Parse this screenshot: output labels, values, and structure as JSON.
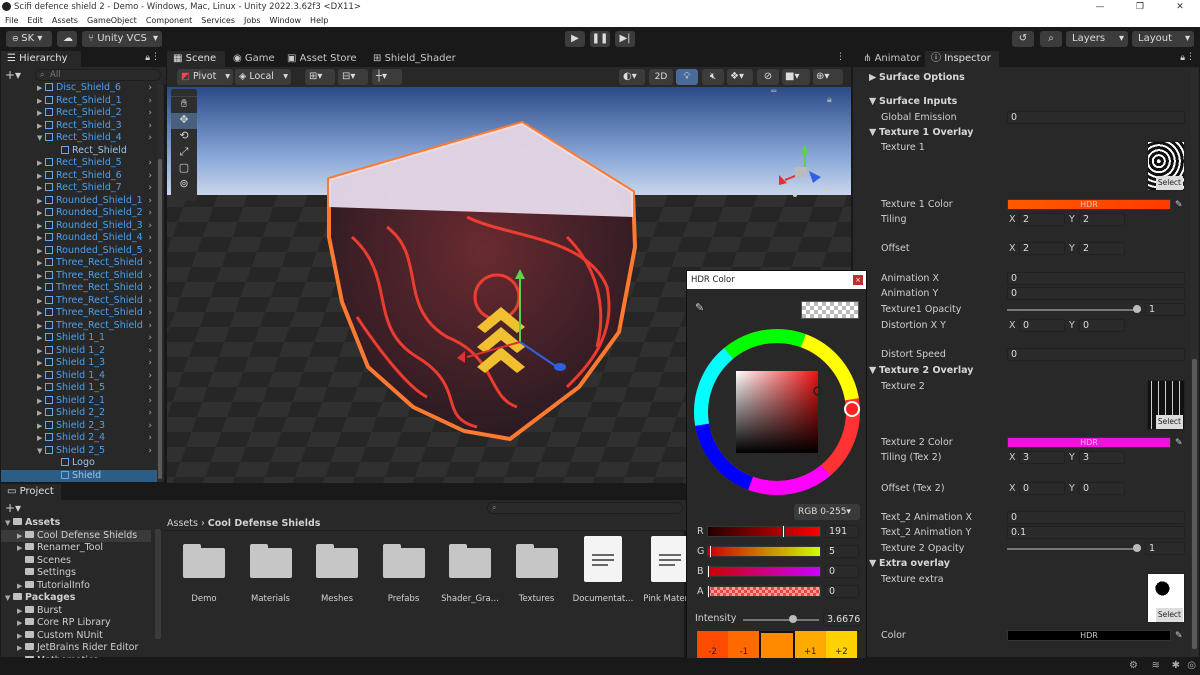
{
  "window": {
    "title": "Scifi defence shield 2 - Demo - Windows, Mac, Linux - Unity 2022.3.62f3 <DX11>",
    "minimize": "—",
    "maximize": "❐",
    "close": "✕"
  },
  "menu": [
    "File",
    "Edit",
    "Assets",
    "GameObject",
    "Component",
    "Services",
    "Jobs",
    "Window",
    "Help"
  ],
  "toolbar": {
    "account": "SK ▾",
    "vcs": "Unity VCS",
    "layers": "Layers",
    "layout": "Layout"
  },
  "hierarchy": {
    "tab": "Hierarchy",
    "search_placeholder": "All",
    "items": [
      {
        "label": "Disc_Shield_6",
        "indent": 1,
        "tri": "▶"
      },
      {
        "label": "Rect_Shield_1",
        "indent": 1,
        "tri": "▶"
      },
      {
        "label": "Rect_Shield_2",
        "indent": 1,
        "tri": "▶"
      },
      {
        "label": "Rect_Shield_3",
        "indent": 1,
        "tri": "▶"
      },
      {
        "label": "Rect_Shield_4",
        "indent": 1,
        "tri": "▼"
      },
      {
        "label": "Rect_Shield",
        "indent": 2,
        "tri": ""
      },
      {
        "label": "Rect_Shield_5",
        "indent": 1,
        "tri": "▶"
      },
      {
        "label": "Rect_Shield_6",
        "indent": 1,
        "tri": "▶"
      },
      {
        "label": "Rect_Shield_7",
        "indent": 1,
        "tri": "▶"
      },
      {
        "label": "Rounded_Shield_1",
        "indent": 1,
        "tri": "▶"
      },
      {
        "label": "Rounded_Shield_2",
        "indent": 1,
        "tri": "▶"
      },
      {
        "label": "Rounded_Shield_3",
        "indent": 1,
        "tri": "▶"
      },
      {
        "label": "Rounded_Shield_4",
        "indent": 1,
        "tri": "▶"
      },
      {
        "label": "Rounded_Shield_5",
        "indent": 1,
        "tri": "▶"
      },
      {
        "label": "Three_Rect_Shield",
        "indent": 1,
        "tri": "▶"
      },
      {
        "label": "Three_Rect_Shield",
        "indent": 1,
        "tri": "▶"
      },
      {
        "label": "Three_Rect_Shield",
        "indent": 1,
        "tri": "▶"
      },
      {
        "label": "Three_Rect_Shield",
        "indent": 1,
        "tri": "▶"
      },
      {
        "label": "Three_Rect_Shield",
        "indent": 1,
        "tri": "▶"
      },
      {
        "label": "Three_Rect_Shield",
        "indent": 1,
        "tri": "▶"
      },
      {
        "label": "Shield 1_1",
        "indent": 1,
        "tri": "▶"
      },
      {
        "label": "Shield 1_2",
        "indent": 1,
        "tri": "▶"
      },
      {
        "label": "Shield 1_3",
        "indent": 1,
        "tri": "▶"
      },
      {
        "label": "Shield 1_4",
        "indent": 1,
        "tri": "▶"
      },
      {
        "label": "Shield 1_5",
        "indent": 1,
        "tri": "▶"
      },
      {
        "label": "Shield 2_1",
        "indent": 1,
        "tri": "▶"
      },
      {
        "label": "Shield 2_2",
        "indent": 1,
        "tri": "▶"
      },
      {
        "label": "Shield 2_3",
        "indent": 1,
        "tri": "▶"
      },
      {
        "label": "Shield 2_4",
        "indent": 1,
        "tri": "▶"
      },
      {
        "label": "Shield 2_5",
        "indent": 1,
        "tri": "▼"
      },
      {
        "label": "Logo",
        "indent": 2,
        "tri": ""
      },
      {
        "label": "Shield",
        "indent": 2,
        "tri": ""
      }
    ]
  },
  "scene": {
    "tabs": [
      "Scene",
      "Game",
      "Asset Store",
      "Shield_Shader"
    ],
    "pivot": "Pivot",
    "local": "Local",
    "twod": "2D"
  },
  "inspector": {
    "tabs": [
      "Animator",
      "Inspector"
    ],
    "rows": [
      {
        "label": "Surface Options",
        "kind": "header",
        "tri": "▶"
      },
      {
        "label": "Surface Inputs",
        "kind": "header",
        "tri": "▼"
      },
      {
        "label": "Global Emission",
        "kind": "value",
        "value": "0"
      },
      {
        "label": "Texture 1 Overlay",
        "kind": "header",
        "tri": "▼"
      },
      {
        "label": "Texture 1",
        "kind": "texture"
      },
      {
        "label": "Texture 1 Color",
        "kind": "color",
        "value": "HDR"
      },
      {
        "label": "Tiling",
        "kind": "xy",
        "x": "2",
        "y": "2"
      },
      {
        "label": "Offset",
        "kind": "xy",
        "x": "2",
        "y": "2"
      },
      {
        "label": "Animation X",
        "kind": "value",
        "value": "0"
      },
      {
        "label": "Animation Y",
        "kind": "value",
        "value": "0"
      },
      {
        "label": "Texture1 Opacity",
        "kind": "slider",
        "value": "1"
      },
      {
        "label": "Distortion X Y",
        "kind": "xy",
        "x": "0",
        "y": "0"
      },
      {
        "label": "Distort Speed",
        "kind": "value",
        "value": "0"
      },
      {
        "label": "Texture 2 Overlay",
        "kind": "header",
        "tri": "▼"
      },
      {
        "label": "Texture 2",
        "kind": "texture"
      },
      {
        "label": "Texture 2 Color",
        "kind": "color",
        "value": "HDR"
      },
      {
        "label": "Tiling (Tex 2)",
        "kind": "xy",
        "x": "3",
        "y": "3"
      },
      {
        "label": "Offset (Tex 2)",
        "kind": "xy",
        "x": "0",
        "y": "0"
      },
      {
        "label": "Text_2 Animation X",
        "kind": "value",
        "value": "0"
      },
      {
        "label": "Text_2 Animation Y",
        "kind": "value",
        "value": "0.1"
      },
      {
        "label": "Texture 2 Opacity",
        "kind": "slider",
        "value": "1"
      },
      {
        "label": "Extra overlay",
        "kind": "header",
        "tri": "▼"
      },
      {
        "label": "Texture extra",
        "kind": "texture"
      },
      {
        "label": "Color",
        "kind": "color",
        "value": "HDR"
      }
    ],
    "select": "Select",
    "x": "X",
    "y": "Y"
  },
  "hdr_color": {
    "title": "HDR Color",
    "mode": "RGB 0-255",
    "channels": [
      {
        "label": "R",
        "value": "191",
        "fill": 0.749
      },
      {
        "label": "G",
        "value": "5",
        "fill": 0.02
      },
      {
        "label": "B",
        "value": "0",
        "fill": 0
      },
      {
        "label": "A",
        "value": "0",
        "fill": 0
      }
    ],
    "intensity_label": "Intensity",
    "intensity_value": "3.6676",
    "swatches": [
      "-2",
      "-1",
      "",
      "+1",
      "+2"
    ],
    "colors": {
      "swatch_m2": "#ff4a00",
      "swatch_m1": "#ff6a00",
      "swatch_0": "#ff8a00",
      "swatch_p1": "#ffaa00",
      "swatch_p2": "#ffd200"
    }
  },
  "project": {
    "tab": "Project",
    "breadcrumb": [
      "Assets",
      "Cool Defense Shields"
    ],
    "tree": [
      {
        "label": "Assets",
        "indent": 0,
        "tri": "▼",
        "bold": true
      },
      {
        "label": "Cool Defense Shields",
        "indent": 1,
        "tri": "▶",
        "selected": true
      },
      {
        "label": "Renamer_Tool",
        "indent": 1,
        "tri": "▶"
      },
      {
        "label": "Scenes",
        "indent": 1,
        "tri": ""
      },
      {
        "label": "Settings",
        "indent": 1,
        "tri": ""
      },
      {
        "label": "TutorialInfo",
        "indent": 1,
        "tri": "▶"
      },
      {
        "label": "Packages",
        "indent": 0,
        "tri": "▼",
        "bold": true
      },
      {
        "label": "Burst",
        "indent": 1,
        "tri": "▶"
      },
      {
        "label": "Core RP Library",
        "indent": 1,
        "tri": "▶"
      },
      {
        "label": "Custom NUnit",
        "indent": 1,
        "tri": "▶"
      },
      {
        "label": "JetBrains Rider Editor",
        "indent": 1,
        "tri": "▶"
      },
      {
        "label": "Mathematics",
        "indent": 1,
        "tri": "▶"
      }
    ],
    "assets": [
      {
        "label": "Demo",
        "type": "folder"
      },
      {
        "label": "Materials",
        "type": "folder"
      },
      {
        "label": "Meshes",
        "type": "folder"
      },
      {
        "label": "Prefabs",
        "type": "folder"
      },
      {
        "label": "Shader_Gra...",
        "type": "folder"
      },
      {
        "label": "Textures",
        "type": "folder"
      },
      {
        "label": "Documentat...",
        "type": "doc"
      },
      {
        "label": "Pink Materia",
        "type": "doc"
      }
    ]
  }
}
